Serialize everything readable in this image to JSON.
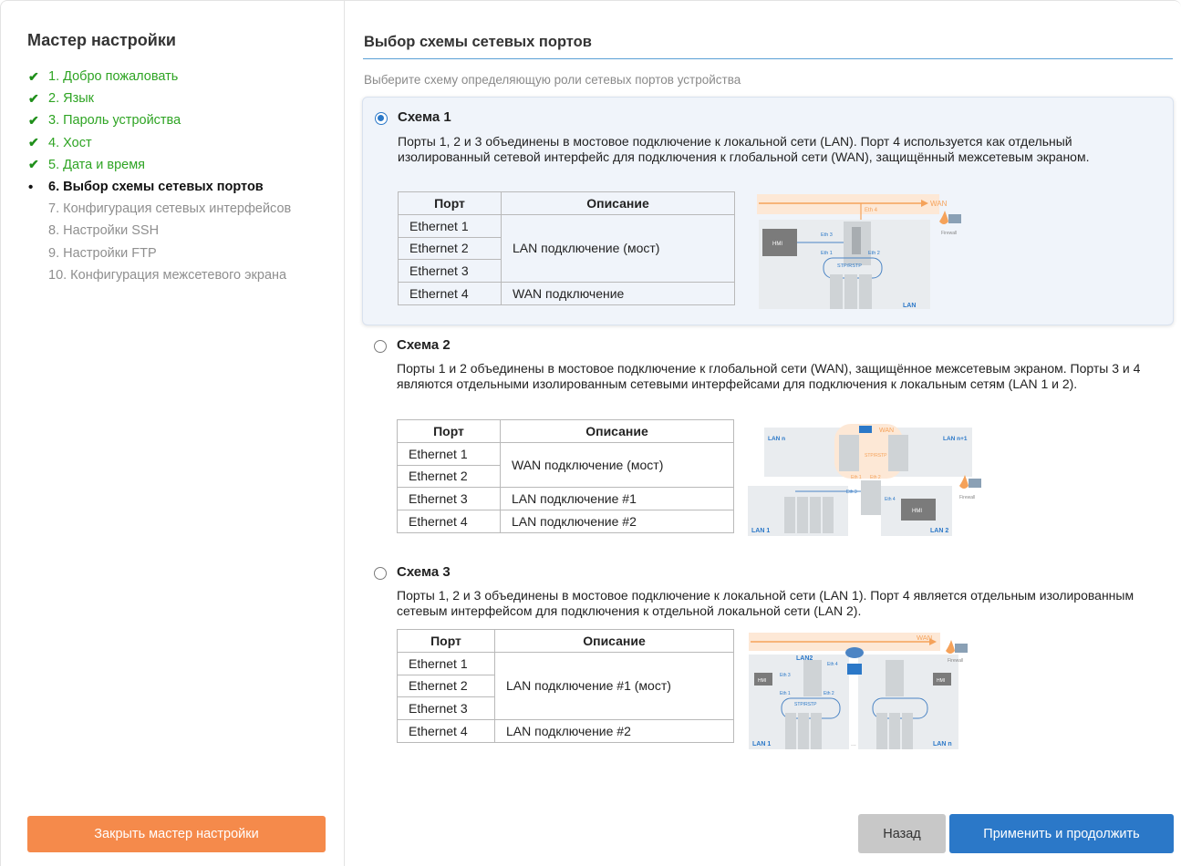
{
  "sidebar": {
    "title": "Мастер настройки",
    "steps": [
      {
        "label": "1. Добро пожаловать",
        "state": "done"
      },
      {
        "label": "2. Язык",
        "state": "done"
      },
      {
        "label": "3. Пароль устройства",
        "state": "done"
      },
      {
        "label": "4. Хост",
        "state": "done"
      },
      {
        "label": "5. Дата и время",
        "state": "done"
      },
      {
        "label": "6. Выбор схемы сетевых портов",
        "state": "current"
      },
      {
        "label": "7. Конфигурация сетевых интерфейсов",
        "state": "todo"
      },
      {
        "label": "8. Настройки SSH",
        "state": "todo"
      },
      {
        "label": "9. Настройки FTP",
        "state": "todo"
      },
      {
        "label": "10. Конфигурация межсетевого экрана",
        "state": "todo"
      }
    ],
    "done_mark": "✔",
    "current_mark": "•",
    "close_button": "Закрыть мастер настройки"
  },
  "main": {
    "title": "Выбор схемы сетевых портов",
    "subtitle": "Выберите схему определяющую роли сетевых портов устройства",
    "table_header": {
      "port": "Порт",
      "desc": "Описание"
    },
    "schemes": [
      {
        "title": "Схема 1",
        "selected": true,
        "description": "Порты 1, 2 и 3 объединены в мостовое подключение к локальной сети (LAN). Порт 4 используется как отдельный изолированный сетевой интерфейс для подключения к глобальной сети (WAN), защищённый межсетевым экраном.",
        "rows": [
          {
            "port": "Ethernet 1",
            "desc": "LAN подключение (мост)"
          },
          {
            "port": "Ethernet 2",
            "desc": ""
          },
          {
            "port": "Ethernet 3",
            "desc": ""
          },
          {
            "port": "Ethernet 4",
            "desc": "WAN подключение"
          }
        ],
        "diagram": {
          "wan": "WAN",
          "eth4": "Eth 4",
          "eth3": "Eth 3",
          "eth1": "Eth 1",
          "eth2": "Eth 2",
          "hmi": "HMI",
          "stp": "STP/RSTP",
          "firewall": "Firewall",
          "lan": "LAN"
        }
      },
      {
        "title": "Схема 2",
        "selected": false,
        "description": "Порты 1 и 2 объединены в мостовое подключение к глобальной сети (WAN), защищённое межсетевым экраном. Порты 3 и 4 являются отдельными изолированным сетевыми интерфейсами для подключения к локальным сетям (LAN 1 и 2).",
        "rows": [
          {
            "port": "Ethernet 1",
            "desc": "WAN подключение (мост)"
          },
          {
            "port": "Ethernet 2",
            "desc": ""
          },
          {
            "port": "Ethernet 3",
            "desc": "LAN подключение #1"
          },
          {
            "port": "Ethernet 4",
            "desc": "LAN подключение #2"
          }
        ],
        "diagram": {
          "wan": "WAN",
          "lan_n": "LAN n",
          "lan_n1": "LAN n+1",
          "stp": "STP/RSTP",
          "eth1": "Eth 1",
          "eth2": "Eth 2",
          "eth3": "Eth 3",
          "eth4": "Eth 4",
          "hmi": "HMI",
          "firewall": "Firewall",
          "lan1": "LAN 1",
          "lan2": "LAN 2"
        }
      },
      {
        "title": "Схема 3",
        "selected": false,
        "description": "Порты 1, 2 и 3 объединены в мостовое подключение к локальной сети (LAN 1). Порт 4 является отдельным изолированным сетевым интерфейсом для подключения к отдельной локальной сети (LAN 2).",
        "rows": [
          {
            "port": "Ethernet 1",
            "desc": "LAN подключение #1 (мост)"
          },
          {
            "port": "Ethernet 2",
            "desc": ""
          },
          {
            "port": "Ethernet 3",
            "desc": ""
          },
          {
            "port": "Ethernet 4",
            "desc": "LAN подключение #2"
          }
        ],
        "diagram": {
          "wan": "WAN",
          "lan2": "LAN2",
          "eth4": "Eth 4",
          "eth3": "Eth 3",
          "eth1": "Eth 1",
          "eth2": "Eth 2",
          "hmi": "HMI",
          "stp": "STP/RSTP",
          "firewall": "Firewall",
          "lan1": "LAN 1",
          "lan_n": "LAN n",
          "dots": "..."
        }
      }
    ]
  },
  "footer": {
    "back_button": "Назад",
    "next_button": "Применить и продолжить"
  },
  "colors": {
    "done_green": "#2ea423",
    "accent_blue": "#2b78c8",
    "close_orange": "#f58a4b",
    "wan_orange": "#f5a25a",
    "lan_label_blue": "#2b78c8"
  }
}
